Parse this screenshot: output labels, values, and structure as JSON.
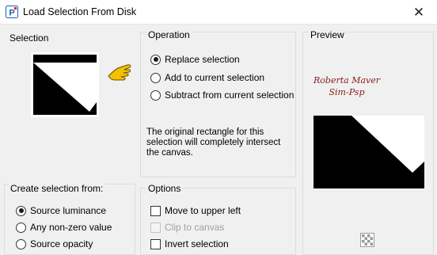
{
  "window": {
    "title": "Load Selection From Disk",
    "close_glyph": "✕"
  },
  "selection": {
    "heading": "Selection"
  },
  "operation": {
    "heading": "Operation",
    "options": [
      {
        "label": "Replace selection",
        "checked": true
      },
      {
        "label": "Add to current selection",
        "checked": false
      },
      {
        "label": "Subtract from current selection",
        "checked": false
      }
    ],
    "description": "The original rectangle for this selection will completely intersect the canvas."
  },
  "preview": {
    "heading": "Preview",
    "watermark_lines": [
      "Roberta Maver",
      "Sim-Psp"
    ]
  },
  "create_from": {
    "heading": "Create selection from:",
    "options": [
      {
        "label": "Source luminance",
        "checked": true
      },
      {
        "label": "Any non-zero value",
        "checked": false
      },
      {
        "label": "Source opacity",
        "checked": false
      }
    ]
  },
  "options": {
    "heading": "Options",
    "items": [
      {
        "label": "Move to upper left",
        "checked": false,
        "disabled": false
      },
      {
        "label": "Clip to canvas",
        "checked": false,
        "disabled": true
      },
      {
        "label": "Invert selection",
        "checked": false,
        "disabled": false
      }
    ]
  },
  "colors": {
    "dialog_bg": "#f0f0f0",
    "title_bg": "#ffffff",
    "signature": "#8b1a1a",
    "pointer_hand": "#f2c200"
  },
  "icons": {
    "app": "paintshop-icon",
    "close": "close-icon",
    "pointer": "pointing-hand-icon",
    "transparency": "checkerboard-icon"
  }
}
